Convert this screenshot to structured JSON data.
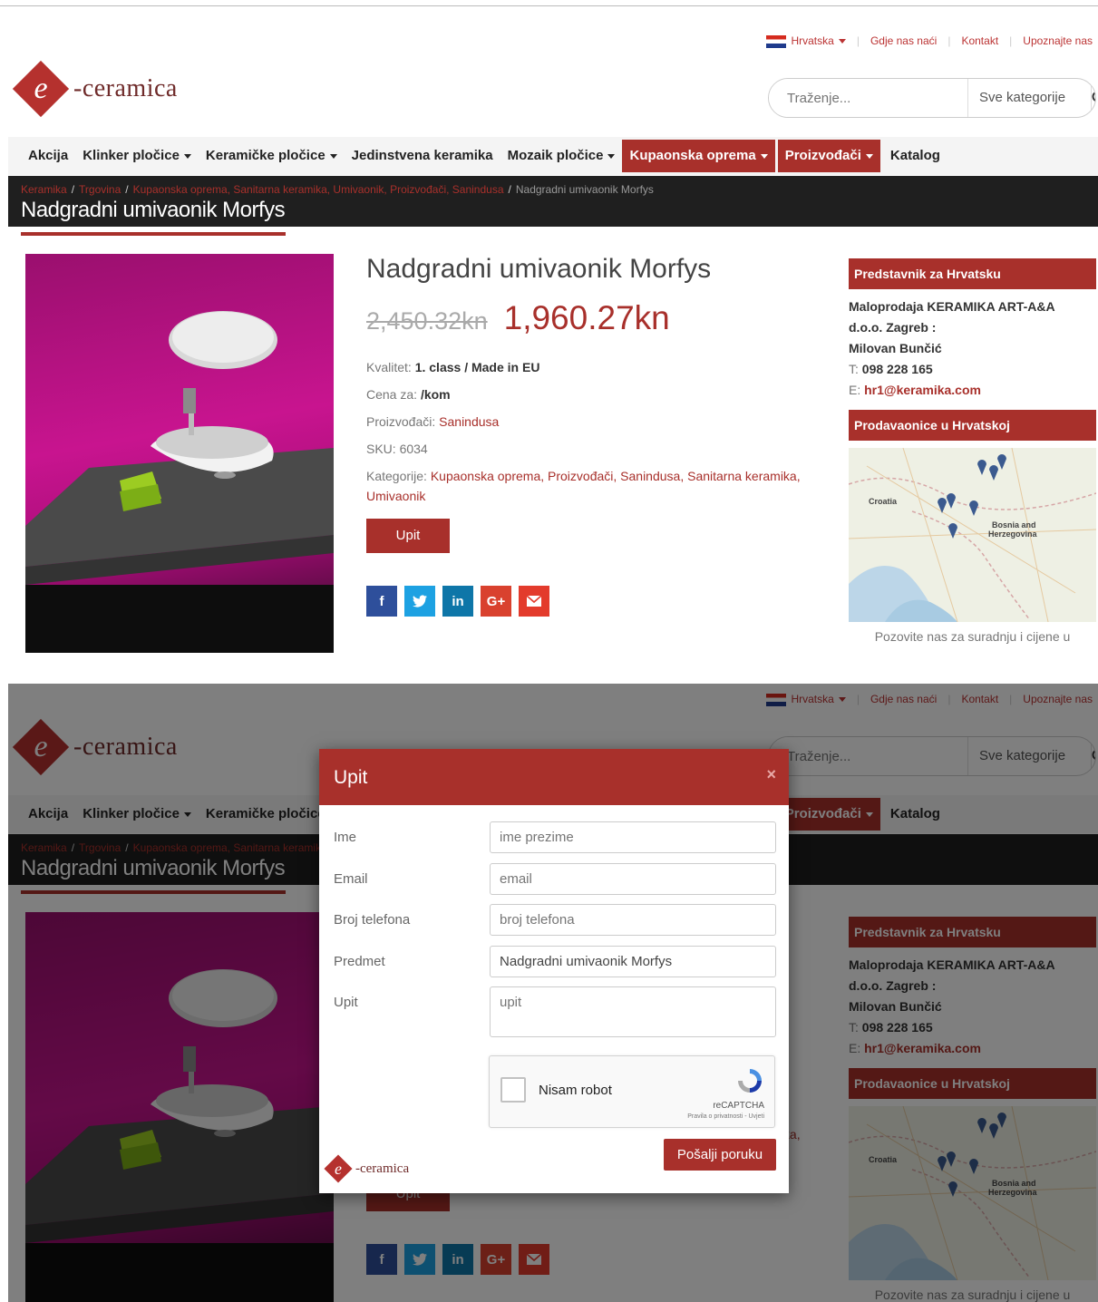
{
  "header": {
    "country": "Hrvatska",
    "links": [
      "Gdje nas naći",
      "Kontakt",
      "Upoznajte nas"
    ],
    "logo_letter": "e",
    "logo_word": "-ceramica",
    "search_placeholder": "Traženje...",
    "search_category": "Sve kategorije"
  },
  "nav": [
    {
      "label": "Akcija",
      "dropdown": false,
      "active": false
    },
    {
      "label": "Klinker pločice",
      "dropdown": true,
      "active": false
    },
    {
      "label": "Keramičke pločice",
      "dropdown": true,
      "active": false
    },
    {
      "label": "Jedinstvena keramika",
      "dropdown": false,
      "active": false
    },
    {
      "label": "Mozaik pločice",
      "dropdown": true,
      "active": false
    },
    {
      "label": "Kupaonska oprema",
      "dropdown": true,
      "active": true
    },
    {
      "label": "Proizvođači",
      "dropdown": true,
      "active": true
    },
    {
      "label": "Katalog",
      "dropdown": false,
      "active": false
    }
  ],
  "breadcrumb": {
    "home": "Keramika",
    "shop": "Trgovina",
    "categories": "Kupaonska oprema, Sanitarna keramika, Umivaonik, Proizvođači, Sanindusa",
    "current": "Nadgradni umivaonik Morfys"
  },
  "page_title": "Nadgradni umivaonik Morfys",
  "product": {
    "name": "Nadgradni umivaonik Morfys",
    "old_price": "2,450.32kn",
    "new_price": "1,960.27kn",
    "quality_label": "Kvalitet:",
    "quality_value": "1. class / Made in EU",
    "unit_label": "Cena za:",
    "unit_value": "/kom",
    "maker_label": "Proizvođači:",
    "maker_value": "Sanindusa",
    "sku_label": "SKU:",
    "sku_value": "6034",
    "categories_label": "Kategorije:",
    "categories_value": "Kupaonska oprema, Proizvođači, Sanindusa, Sanitarna keramika, Umivaonik",
    "inquiry_button": "Upit",
    "share_icons": [
      "facebook-icon",
      "twitter-icon",
      "linkedin-icon",
      "google-plus-icon",
      "email-icon"
    ]
  },
  "sidebar": {
    "rep_title": "Predstavnik za Hrvatsku",
    "rep_company_1": "Maloprodaja KERAMIKA ART-A&A",
    "rep_company_2": "d.o.o. Zagreb :",
    "rep_person": "Milovan Bunčić",
    "phone_label": "T:",
    "phone": "098 228 165",
    "email_label": "E:",
    "email": "hr1@keramika.com",
    "stores_title": "Prodavaonice u Hrvatskoj",
    "map_label_1": "Croatia",
    "map_label_2": "Bosnia and",
    "map_label_3": "Herzegovina",
    "caption": "Pozovite nas za suradnju i cijene u"
  },
  "modal": {
    "title": "Upit",
    "close": "×",
    "fields": [
      {
        "label": "Ime",
        "value": "",
        "placeholder": "ime prezime"
      },
      {
        "label": "Email",
        "value": "",
        "placeholder": "email"
      },
      {
        "label": "Broj telefona",
        "value": "",
        "placeholder": "broj telefona"
      },
      {
        "label": "Predmet",
        "value": "Nadgradni umivaonik Morfys",
        "placeholder": ""
      },
      {
        "label": "Upit",
        "value": "",
        "placeholder": "upit"
      }
    ],
    "captcha_text": "Nisam robot",
    "captcha_brand": "reCAPTCHA",
    "captcha_terms": "Pravila o privatnosti - Uvjeti",
    "send_button": "Pošalji poruku"
  },
  "colors": {
    "brand": "#a8302b",
    "dark_bar": "#1f1f1f"
  }
}
